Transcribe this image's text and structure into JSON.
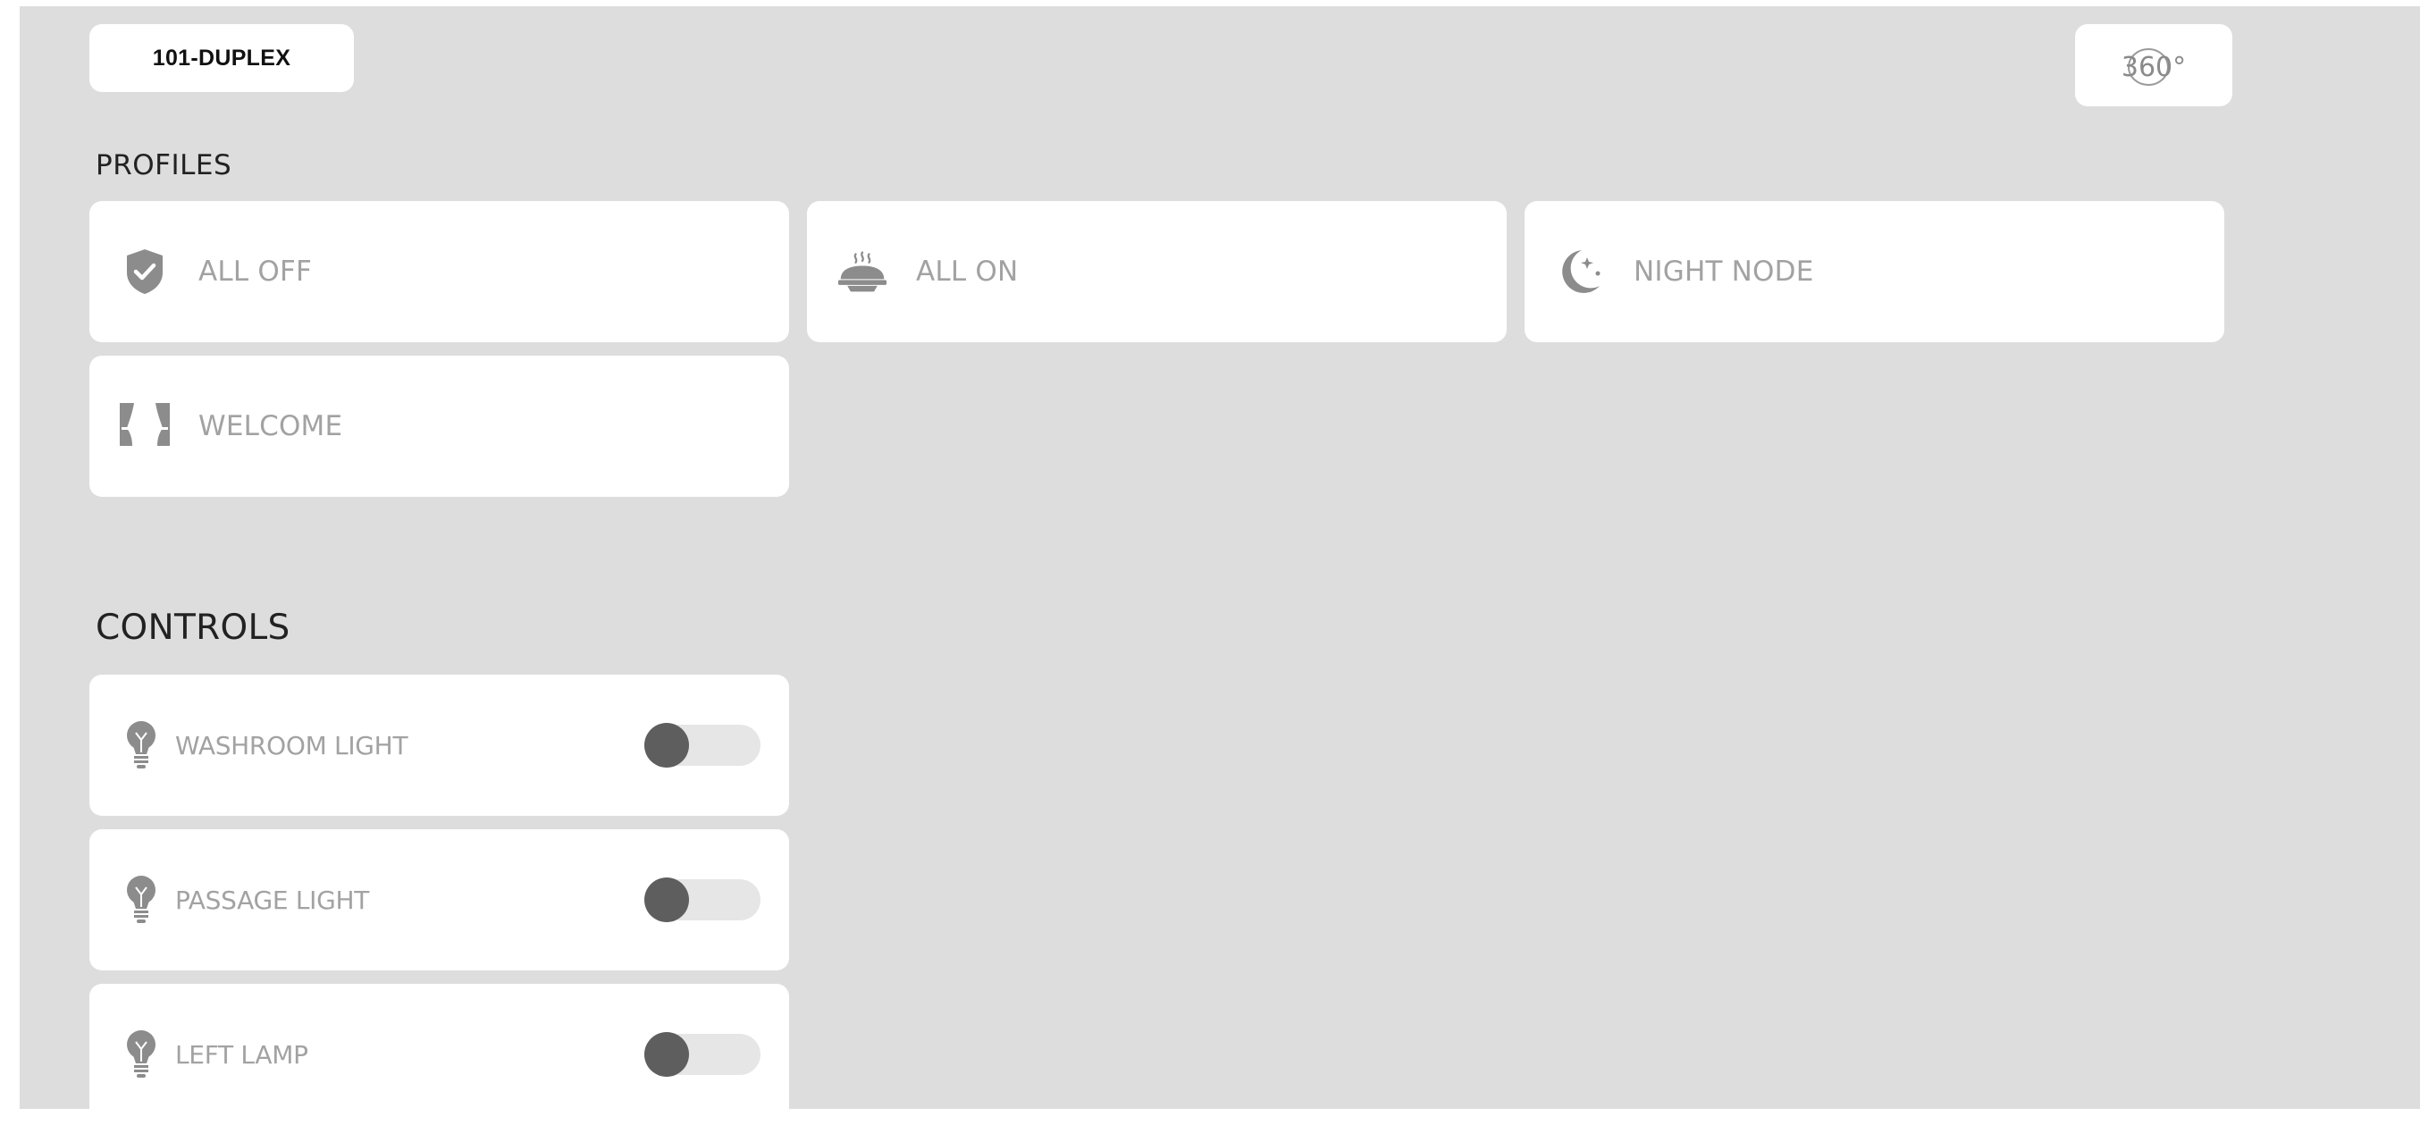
{
  "header": {
    "room_name": "101-DUPLEX",
    "view_button_label": "360°"
  },
  "profiles": {
    "title": "PROFILES",
    "items": [
      {
        "label": "ALL OFF",
        "icon": "shield-check-icon"
      },
      {
        "label": "ALL ON",
        "icon": "cloche-icon"
      },
      {
        "label": "NIGHT NODE",
        "icon": "moon-icon"
      },
      {
        "label": "WELCOME",
        "icon": "curtains-icon"
      }
    ]
  },
  "controls": {
    "title": "CONTROLS",
    "items": [
      {
        "label": "WASHROOM LIGHT",
        "icon": "bulb-icon",
        "state": "off"
      },
      {
        "label": "PASSAGE LIGHT",
        "icon": "bulb-icon",
        "state": "off"
      },
      {
        "label": "LEFT LAMP",
        "icon": "bulb-icon",
        "state": "off"
      }
    ]
  },
  "colors": {
    "background": "#dddddd",
    "card": "#ffffff",
    "label": "#a2a2a2",
    "icon": "#8c8c8c",
    "toggle_track": "#e6e6e6",
    "toggle_knob": "#5e5e5e"
  }
}
